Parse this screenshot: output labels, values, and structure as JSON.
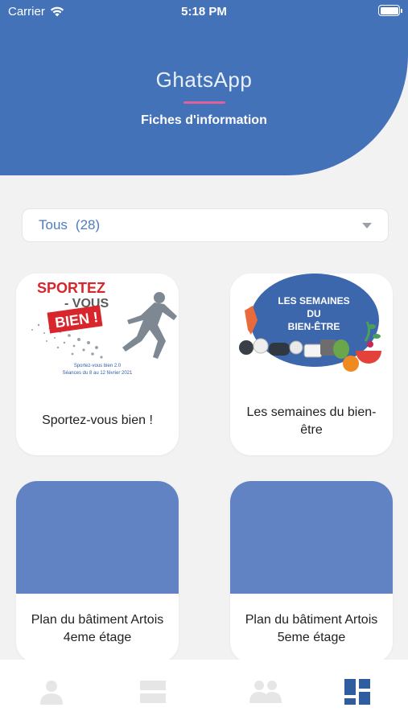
{
  "status": {
    "carrier": "Carrier",
    "time": "5:18 PM"
  },
  "header": {
    "app_title": "GhatsApp",
    "subtitle": "Fiches d'information"
  },
  "filter": {
    "label": "Tous",
    "count": "(28)"
  },
  "cards": [
    {
      "label": "Sportez-vous bien !",
      "image": {
        "line1": "SPORTEZ",
        "line2": "- VOUS",
        "line3": "BIEN !",
        "caption1": "Sportez-vous bien 2.0",
        "caption2": "Séances du 8 au 12 février 2021"
      }
    },
    {
      "label": "Les semaines du bien-être",
      "image": {
        "line1": "LES SEMAINES",
        "line2": "DU",
        "line3": "BIEN-ÊTRE"
      }
    },
    {
      "label": "Plan du bâtiment Artois 4eme étage"
    },
    {
      "label": "Plan du bâtiment Artois 5eme étage"
    }
  ],
  "tabs": [
    {
      "icon": "person-icon",
      "active": false
    },
    {
      "icon": "list-icon",
      "active": false
    },
    {
      "icon": "group-icon",
      "active": false
    },
    {
      "icon": "dashboard-icon",
      "active": true
    }
  ],
  "colors": {
    "header": "#4472b8",
    "accent_underline": "#e0609a",
    "card_placeholder": "#6182c3",
    "tab_inactive": "#e6e6e6",
    "tab_active": "#2f5d9e"
  }
}
